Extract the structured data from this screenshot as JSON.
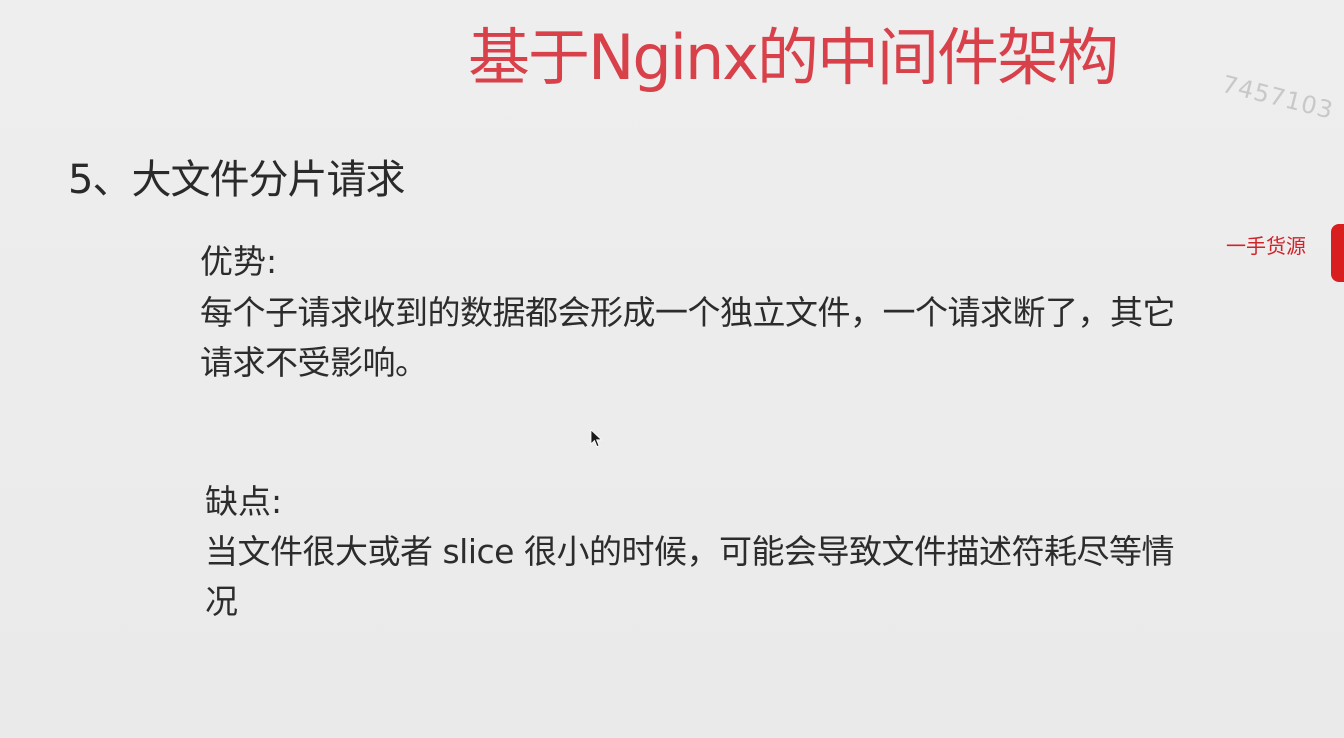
{
  "slide": {
    "title": "基于Nginx的中间件架构",
    "watermark_number": "7457103",
    "watermark_text": "一手货源",
    "section_heading": "5、大文件分片请求",
    "advantages": {
      "label": "优势:",
      "line1": "每个子请求收到的数据都会形成一个独立文件，一个请求断了，其它",
      "line2": "请求不受影响。"
    },
    "disadvantages": {
      "label": "缺点:",
      "line1": "当文件很大或者 slice 很小的时候，可能会导致文件描述符耗尽等情",
      "line2": "况"
    }
  },
  "colors": {
    "title": "#d8404a",
    "watermark_red": "#d0242b",
    "background": "#ececec",
    "text": "#2c2c2c"
  },
  "icons": {
    "cursor": "mouse-pointer-icon"
  }
}
